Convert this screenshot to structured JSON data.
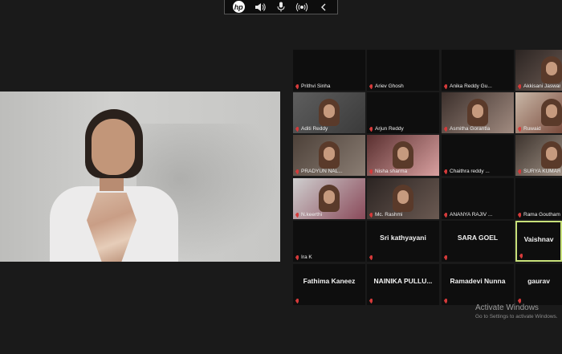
{
  "toolbar": {
    "logo": "hp",
    "icons": [
      "hp-logo-icon",
      "speaker-icon",
      "microphone-icon",
      "broadcast-icon",
      "chevron-left-icon"
    ]
  },
  "speaker": {
    "name": ""
  },
  "participants": [
    {
      "name": "Prithvi Sinha",
      "label": "",
      "video": false
    },
    {
      "name": "Ariev Ghosh",
      "label": "",
      "video": false
    },
    {
      "name": "Anika Reddy Gu...",
      "label": "",
      "video": false
    },
    {
      "name": "Akkisani Jaswan...",
      "label": "",
      "video": true
    },
    {
      "name": "Aditi Reddy",
      "label": "",
      "video": true
    },
    {
      "name": "Arjun Reddy",
      "label": "",
      "video": false
    },
    {
      "name": "Asmitha Gorantla",
      "label": "",
      "video": true
    },
    {
      "name": "Ruwaid",
      "label": "",
      "video": true
    },
    {
      "name": "PRADYUN NAL...",
      "label": "",
      "video": true
    },
    {
      "name": "Nisha sharma",
      "label": "",
      "video": true
    },
    {
      "name": "Chaithra reddy ...",
      "label": "",
      "video": false
    },
    {
      "name": "SURYA KUMARI...",
      "label": "",
      "video": true
    },
    {
      "name": "N.keerthi",
      "label": "",
      "video": true
    },
    {
      "name": "Mc. Rashmi",
      "label": "",
      "video": true
    },
    {
      "name": "ANANYA RAJIV ...",
      "label": "",
      "video": false
    },
    {
      "name": "Rama Gouthami",
      "label": "",
      "video": false
    },
    {
      "name": "Ira K",
      "label": "",
      "video": false
    },
    {
      "name": "",
      "label": "Sri kathyayani",
      "video": false
    },
    {
      "name": "",
      "label": "SARA GOEL",
      "video": false
    },
    {
      "name": "",
      "label": "Vaishnav",
      "video": false,
      "active": true
    },
    {
      "name": "",
      "label": "Fathima Kaneez",
      "video": false
    },
    {
      "name": "",
      "label": "NAINIKA PULLU...",
      "video": false
    },
    {
      "name": "",
      "label": "Ramadevi Nunna",
      "video": false
    },
    {
      "name": "",
      "label": "gaurav",
      "video": false
    }
  ],
  "watermark": {
    "title": "Activate Windows",
    "subtitle": "Go to Settings to activate Windows."
  },
  "colors": {
    "background": "#1a1a1a",
    "tile": "#0e0e0e",
    "muted": "#d63a3a",
    "active_border": "#c7e07a"
  }
}
